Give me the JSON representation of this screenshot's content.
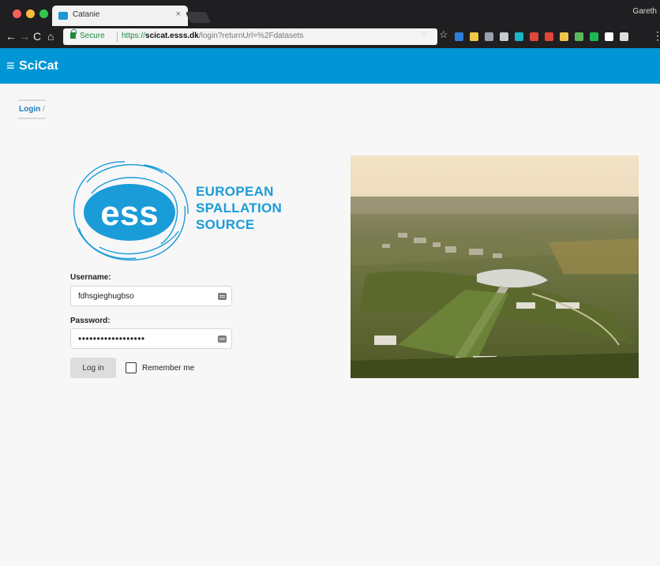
{
  "browser": {
    "tab_title": "Catanie",
    "tab_close": "×",
    "profile_name": "Gareth",
    "security_label": "Secure",
    "url_scheme": "https://",
    "url_host": "scicat.esss.dk",
    "url_path": "/login?returnUrl=%2Fdatasets",
    "nav_back": "←",
    "nav_forward": "→",
    "nav_reload": "C",
    "nav_home": "⌂",
    "key_icon": "o-",
    "star_icon": "☆",
    "menu_icon": "⋮",
    "extension_colors": [
      "#2d7fd8",
      "#f2c744",
      "#9aa3ad",
      "#c7cbd1",
      "#1bb6c6",
      "#e0463a",
      "#e0463a",
      "#f0c64a",
      "#5cb85c",
      "#1db954",
      "#ffffff",
      "#dddddd"
    ]
  },
  "app": {
    "menu_icon": "≡",
    "title": "SciCat",
    "brand_color": "#0096d6"
  },
  "breadcrumb": {
    "current": "Login",
    "separator": "/"
  },
  "logo": {
    "mark_text": "ess",
    "lines": [
      "EUROPEAN",
      "SPALLATION",
      "SOURCE"
    ],
    "color": "#1a9cd8"
  },
  "form": {
    "username_label": "Username:",
    "username_value": "fdhsgieghugbso",
    "password_label": "Password:",
    "password_value": "••••••••••••••••••",
    "login_button": "Log in",
    "remember_label": "Remember me"
  }
}
